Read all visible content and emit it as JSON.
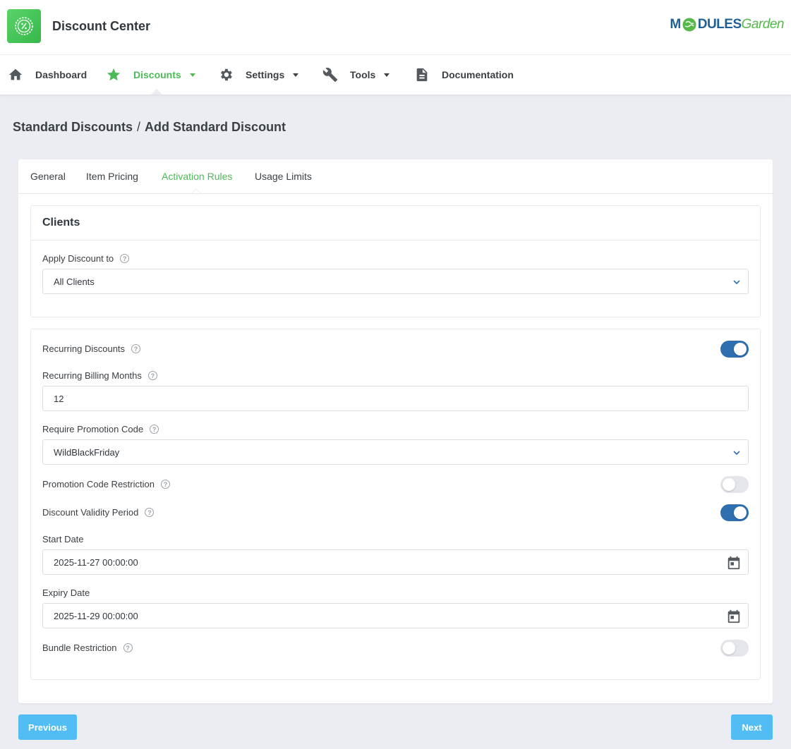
{
  "app": {
    "title": "Discount Center",
    "logo_icon": "discount-badge-icon"
  },
  "brand": {
    "part1": "M",
    "part2": "DULES",
    "part3": "Garden",
    "colors": {
      "primary": "#1f5f96",
      "accent": "#55b949"
    }
  },
  "nav": {
    "items": [
      {
        "label": "Dashboard",
        "icon": "home-icon"
      },
      {
        "label": "Discounts",
        "icon": "star-icon",
        "active": true
      },
      {
        "label": "Settings",
        "icon": "gear-icon"
      },
      {
        "label": "Tools",
        "icon": "wrench-icon"
      },
      {
        "label": "Documentation",
        "icon": "document-icon"
      }
    ]
  },
  "breadcrumb": {
    "parent": "Standard Discounts",
    "separator": "/",
    "current": "Add Standard Discount"
  },
  "tabs": [
    "General",
    "Item Pricing",
    "Activation Rules",
    "Usage Limits"
  ],
  "active_tab": "Activation Rules",
  "clients": {
    "title": "Clients",
    "apply_label": "Apply Discount to",
    "apply_value": "All Clients"
  },
  "rules": {
    "recurring_label": "Recurring Discounts",
    "recurring_on": true,
    "billing_months_label": "Recurring Billing Months",
    "billing_months_value": "12",
    "promo_label": "Require Promotion Code",
    "promo_value": "WildBlackFriday",
    "promo_restriction_label": "Promotion Code Restriction",
    "promo_restriction_on": false,
    "validity_label": "Discount Validity Period",
    "validity_on": true,
    "start_label": "Start Date",
    "start_value": "2025-11-27 00:00:00",
    "expiry_label": "Expiry Date",
    "expiry_value": "2025-11-29 00:00:00",
    "bundle_label": "Bundle Restriction",
    "bundle_on": false
  },
  "buttons": {
    "previous": "Previous",
    "next": "Next"
  },
  "colors": {
    "accent_green": "#4dba57",
    "toggle_on": "#2f6eaf",
    "button_blue": "#52bdf5"
  }
}
